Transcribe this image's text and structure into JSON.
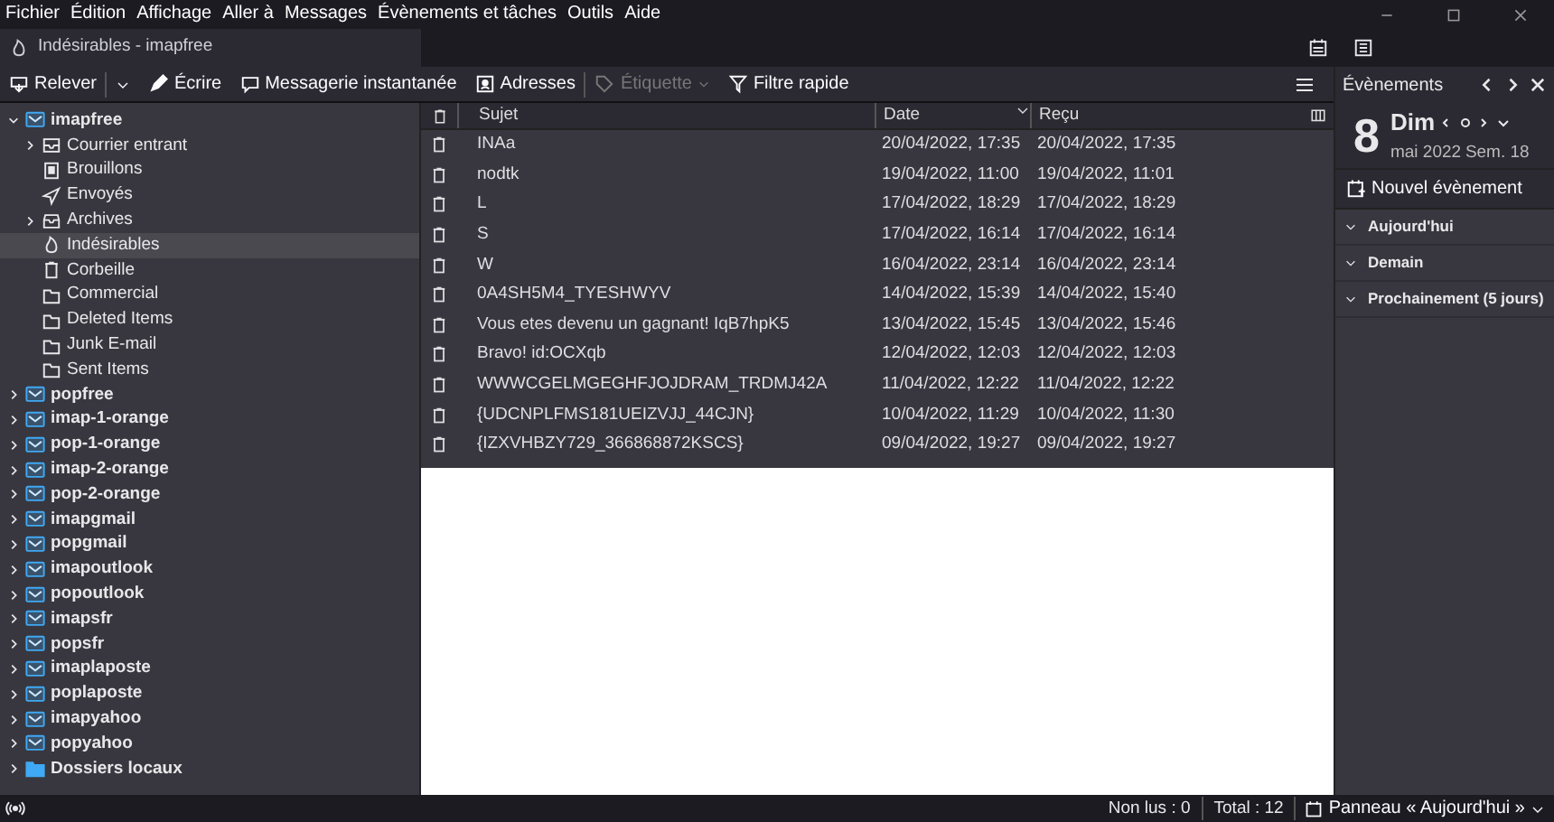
{
  "menu": [
    "Fichier",
    "Édition",
    "Affichage",
    "Aller à",
    "Messages",
    "Évènements et tâches",
    "Outils",
    "Aide"
  ],
  "tab": {
    "title": "Indésirables - imapfree",
    "selected": true
  },
  "toolbar": [
    {
      "kind": "get",
      "label": "Relever",
      "disabled": false
    },
    {
      "kind": "write",
      "label": "Écrire",
      "disabled": false
    },
    {
      "kind": "chat",
      "label": "Messagerie instantanée",
      "disabled": false
    },
    {
      "kind": "address",
      "label": "Adresses",
      "disabled": false
    },
    {
      "kind": "tag",
      "label": "Étiquette",
      "disabled": true
    },
    {
      "kind": "filter",
      "label": "Filtre rapide",
      "disabled": false
    }
  ],
  "folders": [
    {
      "kind": "account",
      "label": "imapfree",
      "expanded": true,
      "selected": false,
      "children": [
        {
          "kind": "inbox",
          "label": "Courrier entrant",
          "expanded": false,
          "selected": false
        },
        {
          "kind": "drafts",
          "label": "Brouillons",
          "selected": false
        },
        {
          "kind": "sent",
          "label": "Envoyés",
          "selected": false
        },
        {
          "kind": "archive",
          "label": "Archives",
          "expanded": false,
          "selected": false
        },
        {
          "kind": "junk",
          "label": "Indésirables",
          "selected": true
        },
        {
          "kind": "trash",
          "label": "Corbeille",
          "selected": false
        },
        {
          "kind": "folder",
          "label": "Commercial",
          "selected": false
        },
        {
          "kind": "folder",
          "label": "Deleted Items",
          "selected": false
        },
        {
          "kind": "folder",
          "label": "Junk E-mail",
          "selected": false
        },
        {
          "kind": "folder",
          "label": "Sent Items",
          "selected": false
        }
      ]
    },
    {
      "kind": "account",
      "label": "popfree",
      "expanded": false,
      "selected": false
    },
    {
      "kind": "account",
      "label": "imap-1-orange",
      "expanded": false,
      "selected": false
    },
    {
      "kind": "account",
      "label": "pop-1-orange",
      "expanded": false,
      "selected": false
    },
    {
      "kind": "account",
      "label": "imap-2-orange",
      "expanded": false,
      "selected": false
    },
    {
      "kind": "account",
      "label": "pop-2-orange",
      "expanded": false,
      "selected": false
    },
    {
      "kind": "account",
      "label": "imapgmail",
      "expanded": false,
      "selected": false
    },
    {
      "kind": "account",
      "label": "popgmail",
      "expanded": false,
      "selected": false
    },
    {
      "kind": "account",
      "label": "imapoutlook",
      "expanded": false,
      "selected": false
    },
    {
      "kind": "account",
      "label": "popoutlook",
      "expanded": false,
      "selected": false
    },
    {
      "kind": "account",
      "label": "imapsfr",
      "expanded": false,
      "selected": false
    },
    {
      "kind": "account",
      "label": "popsfr",
      "expanded": false,
      "selected": false
    },
    {
      "kind": "account",
      "label": "imaplaposte",
      "expanded": false,
      "selected": false
    },
    {
      "kind": "account",
      "label": "poplaposte",
      "expanded": false,
      "selected": false
    },
    {
      "kind": "account",
      "label": "imapyahoo",
      "expanded": false,
      "selected": false
    },
    {
      "kind": "account",
      "label": "popyahoo",
      "expanded": false,
      "selected": false
    },
    {
      "kind": "local",
      "label": "Dossiers locaux",
      "expanded": false,
      "selected": false
    }
  ],
  "table": {
    "columns": [
      "Sujet",
      "Date",
      "Reçu"
    ],
    "rows": [
      [
        "INAa",
        "20/04/2022, 17:35",
        "20/04/2022, 17:35"
      ],
      [
        "nodtk",
        "19/04/2022, 11:00",
        "19/04/2022, 11:01"
      ],
      [
        "L",
        "17/04/2022, 18:29",
        "17/04/2022, 18:29"
      ],
      [
        "S",
        "17/04/2022, 16:14",
        "17/04/2022, 16:14"
      ],
      [
        "W",
        "16/04/2022, 23:14",
        "16/04/2022, 23:14"
      ],
      [
        "0A4SH5M4_TYESHWYV",
        "14/04/2022, 15:39",
        "14/04/2022, 15:40"
      ],
      [
        "Vous etes devenu un gagnant! IqB7hpK5",
        "13/04/2022, 15:45",
        "13/04/2022, 15:46"
      ],
      [
        "Bravo! id:OCXqb",
        "12/04/2022, 12:03",
        "12/04/2022, 12:03"
      ],
      [
        "WWWCGELMGEGHFJOJDRAM_TRDMJ42A",
        "11/04/2022, 12:22",
        "11/04/2022, 12:22"
      ],
      [
        "{UDCNPLFMS181UEIZVJJ_44CJN}",
        "10/04/2022, 11:29",
        "10/04/2022, 11:30"
      ],
      [
        "{IZXVHBZY729_366868872KSCS}",
        "09/04/2022, 19:27",
        "09/04/2022, 19:27"
      ]
    ]
  },
  "today": {
    "title": "Évènements",
    "day": "8",
    "weekday": "Dim",
    "month": "mai 2022",
    "week": "Sem. 18",
    "new_event": "Nouvel évènement",
    "sections": [
      {
        "label": "Aujourd'hui",
        "expanded": true
      },
      {
        "label": "Demain",
        "expanded": true
      },
      {
        "label": "Prochainement (5 jours)",
        "expanded": true
      }
    ]
  },
  "status": {
    "unread": "Non lus : 0",
    "total": "Total : 12",
    "panel": "Panneau « Aujourd'hui »"
  }
}
